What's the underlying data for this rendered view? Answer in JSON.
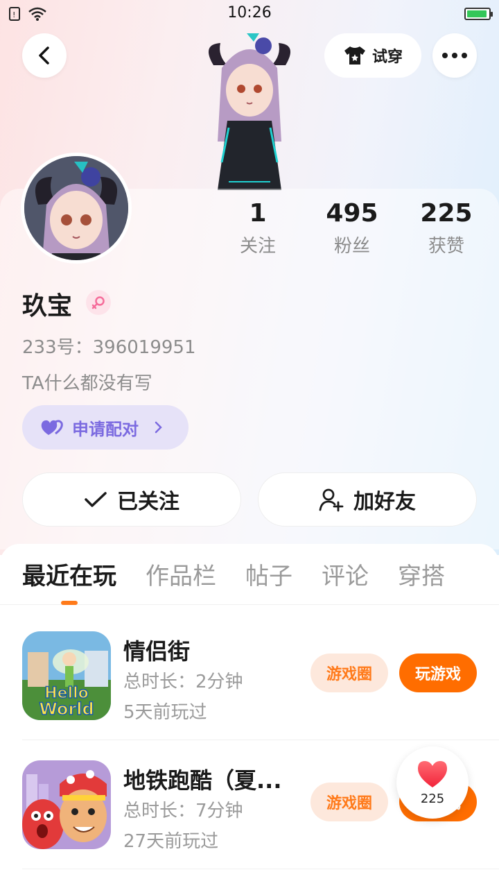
{
  "status_bar": {
    "time": "10:26"
  },
  "header": {
    "tryon_label": "试穿"
  },
  "profile": {
    "stats": [
      {
        "value": "1",
        "label": "关注"
      },
      {
        "value": "495",
        "label": "粉丝"
      },
      {
        "value": "225",
        "label": "获赞"
      }
    ],
    "nickname": "玖宝",
    "id_line": "233号：396019951",
    "bio": "TA什么都没有写",
    "pair_label": "申请配对",
    "followed_label": "已关注",
    "add_friend_label": "加好友"
  },
  "tabs": [
    {
      "label": "最近在玩",
      "active": true
    },
    {
      "label": "作品栏",
      "active": false
    },
    {
      "label": "帖子",
      "active": false
    },
    {
      "label": "评论",
      "active": false
    },
    {
      "label": "穿搭",
      "active": false
    }
  ],
  "games": [
    {
      "title": "情侣街",
      "duration": "总时长：2分钟",
      "last_played": "5天前玩过",
      "circle_label": "游戏圈",
      "play_label": "玩游戏",
      "icon": "hello-world-game-icon"
    },
    {
      "title": "地铁跑酷（夏...",
      "duration": "总时长：7分钟",
      "last_played": "27天前玩过",
      "circle_label": "游戏圈",
      "play_label": "玩游戏",
      "icon": "subway-surfers-game-icon"
    }
  ],
  "like_float": {
    "count": "225"
  },
  "colors": {
    "accent": "#ff6d00",
    "pair": "#7b6ae0",
    "gender": "#f56c9a"
  }
}
